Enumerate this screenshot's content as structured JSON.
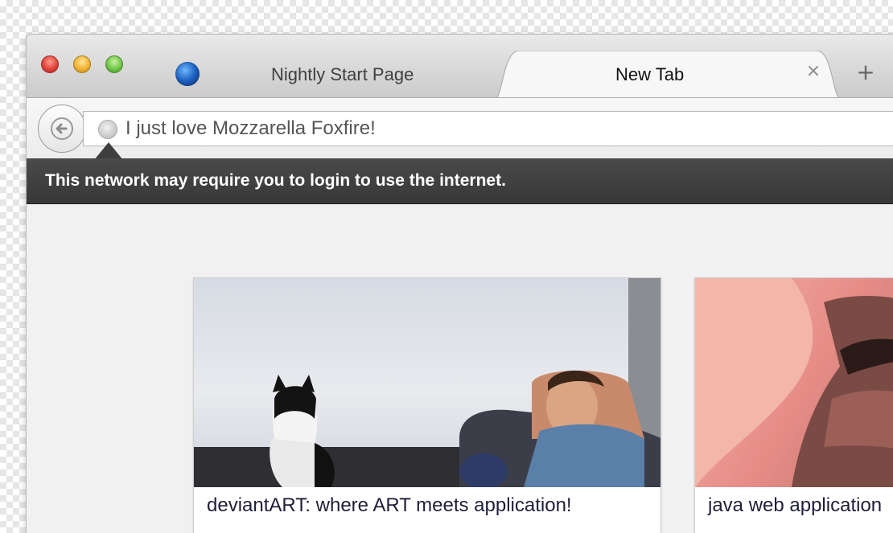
{
  "tabs": [
    {
      "label": "Nightly Start Page",
      "active": false
    },
    {
      "label": "New Tab",
      "active": true
    }
  ],
  "tab_close_glyph": "×",
  "new_tab_glyph": "+",
  "urlbar": {
    "value": "I just love Mozzarella Foxfire!"
  },
  "notification": {
    "text": "This network may require you to login to use the internet."
  },
  "tiles": [
    {
      "title": "deviantART: where ART meets application!"
    },
    {
      "title": "java web application"
    }
  ],
  "colors": {
    "notification_bg": "#3e3e3e",
    "content_bg": "#f1f1f1",
    "tab_active_bg": "#f7f7f7"
  },
  "icons": [
    "close-window-icon",
    "minimize-window-icon",
    "zoom-window-icon",
    "nightly-favicon",
    "close-tab-icon",
    "new-tab-icon",
    "back-arrow-icon",
    "globe-icon"
  ]
}
